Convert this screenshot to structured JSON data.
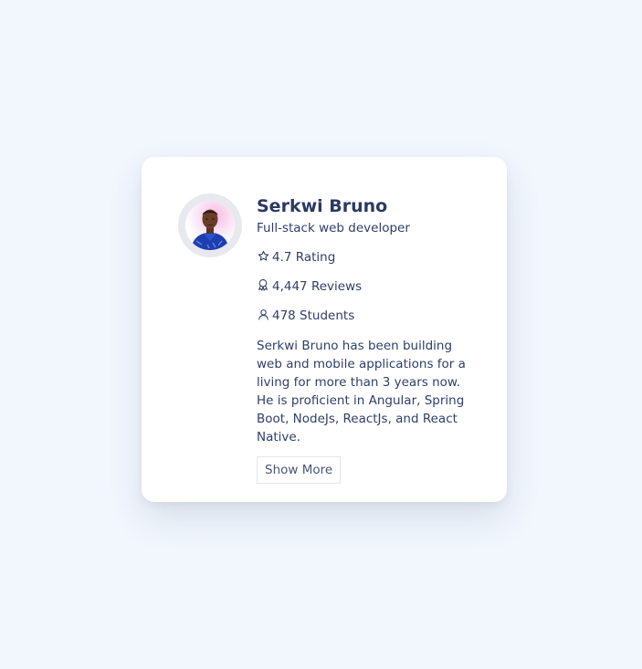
{
  "colors": {
    "page_background": "#f2f7fe",
    "card_background": "#ffffff",
    "text": "#2f4069",
    "name": "#2b3a63"
  },
  "profile": {
    "avatar": "profile-photo",
    "name": "Serkwi Bruno",
    "title": "Full-stack web developer",
    "stats": [
      {
        "icon": "star-icon",
        "label": "4.7 Rating"
      },
      {
        "icon": "award-icon",
        "label": "4,447 Reviews"
      },
      {
        "icon": "user-icon",
        "label": "478 Students"
      }
    ],
    "bio": "Serkwi Bruno has been building web and mobile applications for a living for more than 3 years now. He is proficient in Angular, Spring Boot, NodeJs, ReactJs, and React Native.",
    "show_more_label": "Show More"
  }
}
